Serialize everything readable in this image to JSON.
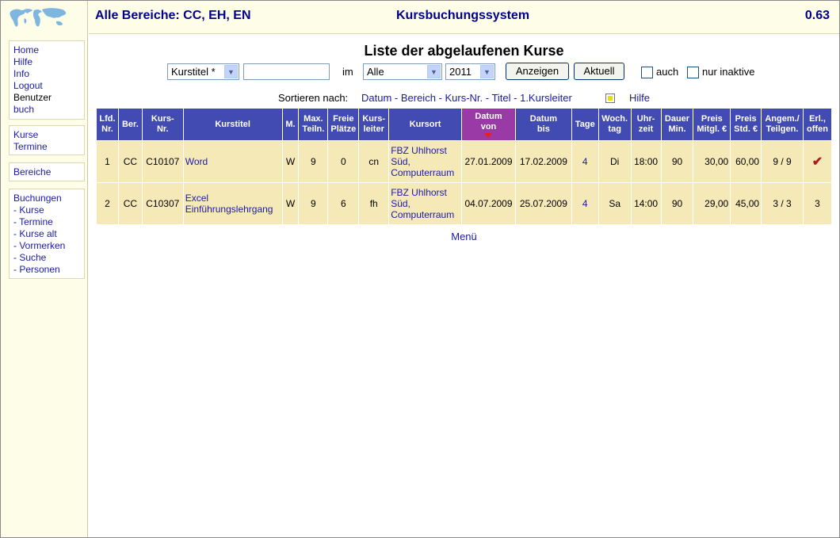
{
  "header": {
    "areas": "Alle Bereiche: CC, EH, EN",
    "system": "Kursbuchungssystem",
    "version": "0.63"
  },
  "sidebar": {
    "group1": [
      {
        "label": "Home",
        "link": true
      },
      {
        "label": "Hilfe",
        "link": true
      },
      {
        "label": "Info",
        "link": true
      },
      {
        "label": "Logout",
        "link": true
      },
      {
        "label": "Benutzer",
        "link": false
      },
      {
        "label": "buch",
        "link": true
      }
    ],
    "group2": [
      "Kurse",
      "Termine"
    ],
    "group3": [
      "Bereiche"
    ],
    "group4": [
      "Buchungen",
      "- Kurse",
      "- Termine",
      "- Kurse alt",
      "- Vormerken",
      "- Suche",
      "- Personen"
    ]
  },
  "page": {
    "title": "Liste der abgelaufenen Kurse",
    "filter": {
      "field_select": "Kurstitel *",
      "search_value": "",
      "in_label": "im",
      "area_select": "Alle",
      "year_select": "2011",
      "show_button": "Anzeigen",
      "current_button": "Aktuell",
      "also_label": "auch",
      "inactive_label": "nur inaktive"
    },
    "sort": {
      "label": "Sortieren nach:",
      "options": "Datum - Bereich - Kurs-Nr. - Titel - 1.Kursleiter",
      "help": "Hilfe"
    },
    "menu_link": "Menü"
  },
  "table": {
    "columns": [
      {
        "line1": "Lfd.",
        "line2": "Nr."
      },
      {
        "line1": "Ber.",
        "line2": ""
      },
      {
        "line1": "Kurs-",
        "line2": "Nr."
      },
      {
        "line1": "Kurstitel",
        "line2": ""
      },
      {
        "line1": "M.",
        "line2": ""
      },
      {
        "line1": "Max.",
        "line2": "Teiln."
      },
      {
        "line1": "Freie",
        "line2": "Plätze"
      },
      {
        "line1": "Kurs-",
        "line2": "leiter"
      },
      {
        "line1": "Kursort",
        "line2": ""
      },
      {
        "line1": "Datum",
        "line2": "von"
      },
      {
        "line1": "Datum",
        "line2": "bis"
      },
      {
        "line1": "Tage",
        "line2": ""
      },
      {
        "line1": "Woch.",
        "line2": "tag"
      },
      {
        "line1": "Uhr-",
        "line2": "zeit"
      },
      {
        "line1": "Dauer",
        "line2": "Min."
      },
      {
        "line1": "Preis",
        "line2": "Mitgl. €"
      },
      {
        "line1": "Preis",
        "line2": "Std. €"
      },
      {
        "line1": "Angem./",
        "line2": "Teilgen."
      },
      {
        "line1": "Erl.,",
        "line2": "offen"
      }
    ],
    "rows": [
      {
        "nr": "1",
        "ber": "CC",
        "kursnr": "C10107",
        "titel1": "Word",
        "titel2": "",
        "m": "W",
        "max": "9",
        "frei": "0",
        "leiter": "cn",
        "ort1": "FBZ Uhlhorst",
        "ort2": "Süd,",
        "ort3": "Computerraum",
        "von": "27.01.2009",
        "bis": "17.02.2009",
        "tage": "4",
        "wtag": "Di",
        "zeit": "18:00",
        "dauer": "90",
        "preis_m": "30,00",
        "preis_s": "60,00",
        "angem": "9 / 9",
        "erl": "✔"
      },
      {
        "nr": "2",
        "ber": "CC",
        "kursnr": "C10307",
        "titel1": "Excel",
        "titel2": "Einführungslehrgang",
        "m": "W",
        "max": "9",
        "frei": "6",
        "leiter": "fh",
        "ort1": "FBZ Uhlhorst",
        "ort2": "Süd,",
        "ort3": "Computerraum",
        "von": "04.07.2009",
        "bis": "25.07.2009",
        "tage": "4",
        "wtag": "Sa",
        "zeit": "14:00",
        "dauer": "90",
        "preis_m": "29,00",
        "preis_s": "45,00",
        "angem": "3 / 3",
        "erl": "3"
      }
    ]
  },
  "colors": {
    "header_bg": "#424bb1",
    "active_header_bg": "#9a3aa6",
    "row_bg": "#f6e9b8",
    "link": "#1a1aa6",
    "title": "#00008b",
    "sidebar_bg": "#fdfde8"
  }
}
